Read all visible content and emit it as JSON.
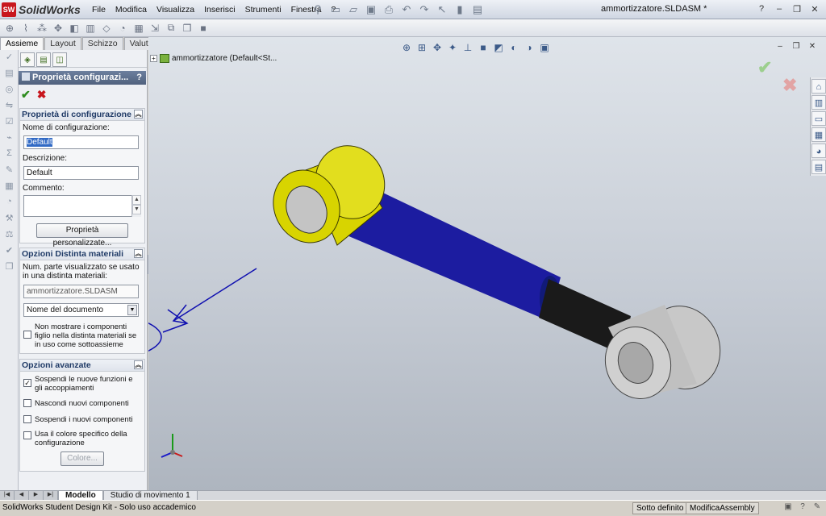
{
  "app": {
    "logo_abbrev": "SW",
    "logo_name": "SolidWorks",
    "document_title": "ammortizzatore.SLDASM *"
  },
  "menu": [
    "File",
    "Modifica",
    "Visualizza",
    "Inserisci",
    "Strumenti",
    "Finestra",
    "?"
  ],
  "command_tabs": [
    "Assieme",
    "Layout",
    "Schizzo",
    "Valutare"
  ],
  "property_manager": {
    "title": "Proprietà configurazi...",
    "help_label": "?",
    "group_config": {
      "title": "Proprietà di configurazione",
      "name_label": "Nome di configurazione:",
      "name_value": "Default",
      "desc_label": "Descrizione:",
      "desc_value": "Default",
      "comment_label": "Commento:",
      "comment_value": "",
      "custom_props_button": "Proprietà personalizzate..."
    },
    "group_bom": {
      "title": "Opzioni Distinta materiali",
      "part_label": "Num. parte visualizzato se usato in una distinta materiali:",
      "part_value": "ammortizzatore.SLDASM",
      "source_select": "Nome del documento",
      "hide_children_label": "Non mostrare i componenti figlio nella distinta materiali se in uso come sottoassieme",
      "hide_children_checked": false
    },
    "group_advanced": {
      "title": "Opzioni avanzate",
      "options": [
        {
          "label": "Sospendi le nuove funzioni e gli accoppiamenti",
          "checked": true
        },
        {
          "label": "Nascondi nuovi componenti",
          "checked": false
        },
        {
          "label": "Sospendi i nuovi componenti",
          "checked": false
        },
        {
          "label": "Usa il colore specifico della configurazione",
          "checked": false
        }
      ],
      "color_button": "Colore..."
    }
  },
  "feature_tree": {
    "root_label": "ammortizzatore  (Default<St..."
  },
  "bottom_tabs": [
    "Modello",
    "Studio di movimento 1"
  ],
  "status_bar": {
    "left": "SolidWorks Student Design Kit - Solo uso accademico",
    "definition": "Sotto definito",
    "mode": "ModificaAssembly"
  },
  "colors": {
    "yellow_part": "#d8d400",
    "blue_part": "#1c1ca0",
    "black_part": "#1a1a1a",
    "gray_part": "#c8c8c8",
    "annotation": "#1010b0"
  },
  "icons": {
    "view_toolbar": [
      "zoom-to-fit-icon",
      "zoom-area-icon",
      "previous-view-icon",
      "section-view-icon",
      "view-orientation-icon",
      "display-style-icon",
      "hide-show-icon",
      "edit-appearance-icon",
      "scene-icon",
      "view-settings-icon"
    ],
    "task_pane": [
      "home-icon",
      "design-library-icon",
      "file-explorer-icon",
      "view-palette-icon",
      "appearances-icon",
      "custom-properties-icon"
    ]
  }
}
